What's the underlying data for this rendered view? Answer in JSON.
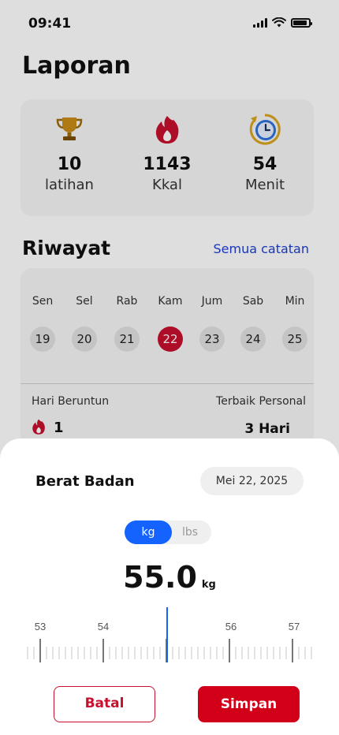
{
  "status_bar": {
    "time": "09:41"
  },
  "page": {
    "title": "Laporan"
  },
  "stats": [
    {
      "icon": "trophy-icon",
      "value": "10",
      "label": "latihan"
    },
    {
      "icon": "flame-icon",
      "value": "1143",
      "label": "Kkal"
    },
    {
      "icon": "clock-icon",
      "value": "54",
      "label": "Menit"
    }
  ],
  "history": {
    "title": "Riwayat",
    "see_all": "Semua catatan",
    "days": [
      {
        "name": "Sen",
        "date": "19"
      },
      {
        "name": "Sel",
        "date": "20"
      },
      {
        "name": "Rab",
        "date": "21"
      },
      {
        "name": "Kam",
        "date": "22"
      },
      {
        "name": "Jum",
        "date": "23"
      },
      {
        "name": "Sab",
        "date": "24"
      },
      {
        "name": "Min",
        "date": "25"
      }
    ],
    "active_date": "22",
    "streak_label": "Hari Beruntun",
    "streak_value": "1",
    "best_label": "Terbaik Personal",
    "best_value": "3 Hari"
  },
  "sheet": {
    "title": "Berat Badan",
    "date": "Mei 22, 2025",
    "units": {
      "selected": "kg",
      "other": "lbs"
    },
    "weight_value": "55.0",
    "weight_unit": "kg",
    "ruler_labels": [
      "53",
      "54",
      "56",
      "57"
    ],
    "cancel_label": "Batal",
    "save_label": "Simpan"
  },
  "colors": {
    "accent_red": "#d10018",
    "accent_blue": "#1463ff",
    "link_blue": "#1d3fd6"
  }
}
